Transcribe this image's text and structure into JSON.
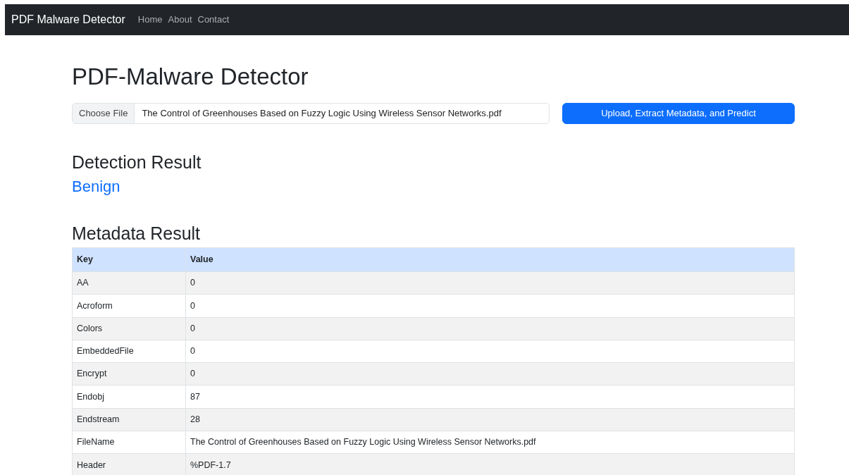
{
  "navbar": {
    "brand": "PDF Malware Detector",
    "links": [
      "Home",
      "About",
      "Contact"
    ]
  },
  "title": "PDF-Malware Detector",
  "upload": {
    "choose_label": "Choose File",
    "file_name": "The Control of Greenhouses Based on Fuzzy Logic Using Wireless Sensor Networks.pdf",
    "button": "Upload, Extract Metadata, and Predict"
  },
  "detection": {
    "heading": "Detection Result",
    "result": "Benign",
    "kind": "benign"
  },
  "metadata": {
    "heading": "Metadata Result",
    "columns": [
      "Key",
      "Value"
    ],
    "rows": [
      [
        "AA",
        "0"
      ],
      [
        "Acroform",
        "0"
      ],
      [
        "Colors",
        "0"
      ],
      [
        "EmbeddedFile",
        "0"
      ],
      [
        "Encrypt",
        "0"
      ],
      [
        "Endobj",
        "87"
      ],
      [
        "Endstream",
        "28"
      ],
      [
        "FileName",
        "The Control of Greenhouses Based on Fuzzy Logic Using Wireless Sensor Networks.pdf"
      ],
      [
        "Header",
        "%PDF-1.7"
      ]
    ]
  }
}
